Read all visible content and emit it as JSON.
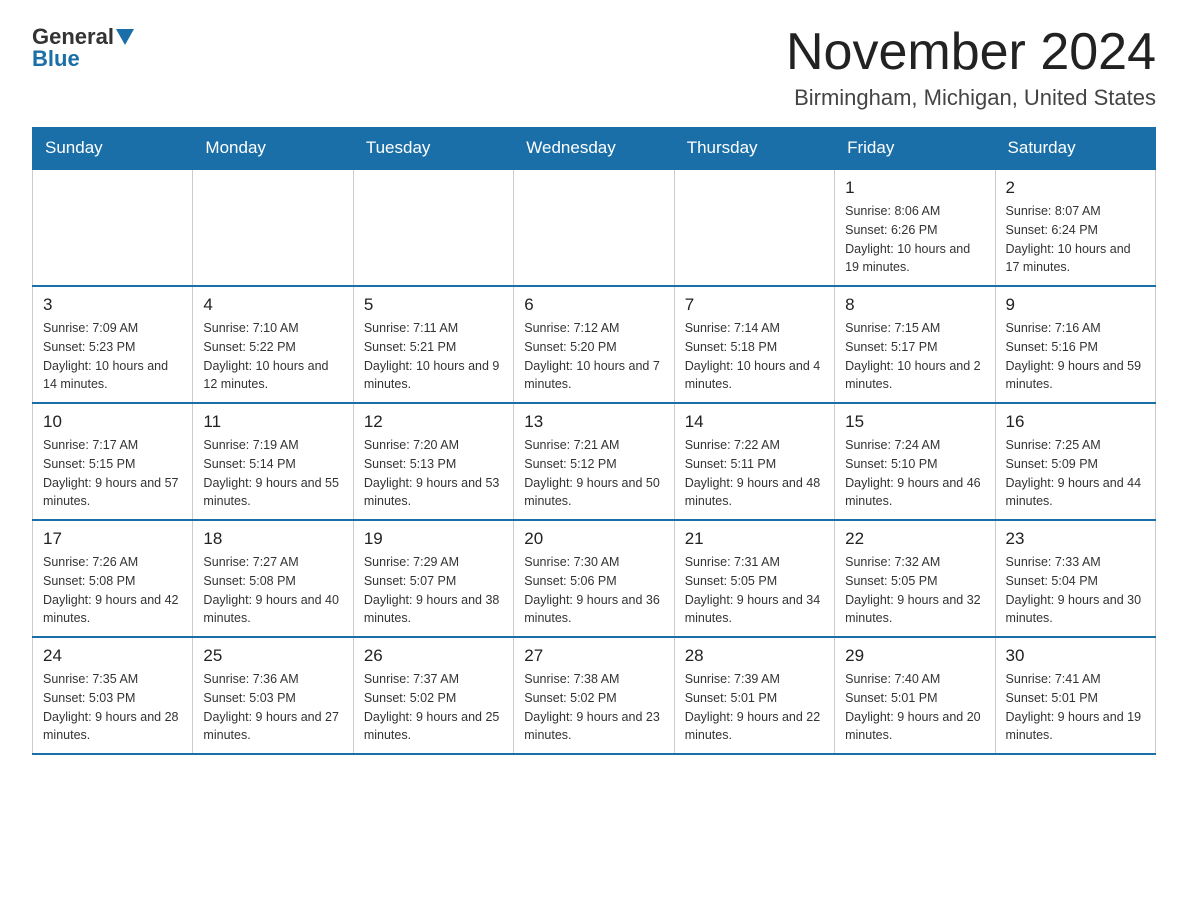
{
  "header": {
    "logo_general": "General",
    "logo_blue": "Blue",
    "month_title": "November 2024",
    "location": "Birmingham, Michigan, United States"
  },
  "days_of_week": [
    "Sunday",
    "Monday",
    "Tuesday",
    "Wednesday",
    "Thursday",
    "Friday",
    "Saturday"
  ],
  "weeks": [
    [
      {
        "day": "",
        "info": ""
      },
      {
        "day": "",
        "info": ""
      },
      {
        "day": "",
        "info": ""
      },
      {
        "day": "",
        "info": ""
      },
      {
        "day": "",
        "info": ""
      },
      {
        "day": "1",
        "info": "Sunrise: 8:06 AM\nSunset: 6:26 PM\nDaylight: 10 hours and 19 minutes."
      },
      {
        "day": "2",
        "info": "Sunrise: 8:07 AM\nSunset: 6:24 PM\nDaylight: 10 hours and 17 minutes."
      }
    ],
    [
      {
        "day": "3",
        "info": "Sunrise: 7:09 AM\nSunset: 5:23 PM\nDaylight: 10 hours and 14 minutes."
      },
      {
        "day": "4",
        "info": "Sunrise: 7:10 AM\nSunset: 5:22 PM\nDaylight: 10 hours and 12 minutes."
      },
      {
        "day": "5",
        "info": "Sunrise: 7:11 AM\nSunset: 5:21 PM\nDaylight: 10 hours and 9 minutes."
      },
      {
        "day": "6",
        "info": "Sunrise: 7:12 AM\nSunset: 5:20 PM\nDaylight: 10 hours and 7 minutes."
      },
      {
        "day": "7",
        "info": "Sunrise: 7:14 AM\nSunset: 5:18 PM\nDaylight: 10 hours and 4 minutes."
      },
      {
        "day": "8",
        "info": "Sunrise: 7:15 AM\nSunset: 5:17 PM\nDaylight: 10 hours and 2 minutes."
      },
      {
        "day": "9",
        "info": "Sunrise: 7:16 AM\nSunset: 5:16 PM\nDaylight: 9 hours and 59 minutes."
      }
    ],
    [
      {
        "day": "10",
        "info": "Sunrise: 7:17 AM\nSunset: 5:15 PM\nDaylight: 9 hours and 57 minutes."
      },
      {
        "day": "11",
        "info": "Sunrise: 7:19 AM\nSunset: 5:14 PM\nDaylight: 9 hours and 55 minutes."
      },
      {
        "day": "12",
        "info": "Sunrise: 7:20 AM\nSunset: 5:13 PM\nDaylight: 9 hours and 53 minutes."
      },
      {
        "day": "13",
        "info": "Sunrise: 7:21 AM\nSunset: 5:12 PM\nDaylight: 9 hours and 50 minutes."
      },
      {
        "day": "14",
        "info": "Sunrise: 7:22 AM\nSunset: 5:11 PM\nDaylight: 9 hours and 48 minutes."
      },
      {
        "day": "15",
        "info": "Sunrise: 7:24 AM\nSunset: 5:10 PM\nDaylight: 9 hours and 46 minutes."
      },
      {
        "day": "16",
        "info": "Sunrise: 7:25 AM\nSunset: 5:09 PM\nDaylight: 9 hours and 44 minutes."
      }
    ],
    [
      {
        "day": "17",
        "info": "Sunrise: 7:26 AM\nSunset: 5:08 PM\nDaylight: 9 hours and 42 minutes."
      },
      {
        "day": "18",
        "info": "Sunrise: 7:27 AM\nSunset: 5:08 PM\nDaylight: 9 hours and 40 minutes."
      },
      {
        "day": "19",
        "info": "Sunrise: 7:29 AM\nSunset: 5:07 PM\nDaylight: 9 hours and 38 minutes."
      },
      {
        "day": "20",
        "info": "Sunrise: 7:30 AM\nSunset: 5:06 PM\nDaylight: 9 hours and 36 minutes."
      },
      {
        "day": "21",
        "info": "Sunrise: 7:31 AM\nSunset: 5:05 PM\nDaylight: 9 hours and 34 minutes."
      },
      {
        "day": "22",
        "info": "Sunrise: 7:32 AM\nSunset: 5:05 PM\nDaylight: 9 hours and 32 minutes."
      },
      {
        "day": "23",
        "info": "Sunrise: 7:33 AM\nSunset: 5:04 PM\nDaylight: 9 hours and 30 minutes."
      }
    ],
    [
      {
        "day": "24",
        "info": "Sunrise: 7:35 AM\nSunset: 5:03 PM\nDaylight: 9 hours and 28 minutes."
      },
      {
        "day": "25",
        "info": "Sunrise: 7:36 AM\nSunset: 5:03 PM\nDaylight: 9 hours and 27 minutes."
      },
      {
        "day": "26",
        "info": "Sunrise: 7:37 AM\nSunset: 5:02 PM\nDaylight: 9 hours and 25 minutes."
      },
      {
        "day": "27",
        "info": "Sunrise: 7:38 AM\nSunset: 5:02 PM\nDaylight: 9 hours and 23 minutes."
      },
      {
        "day": "28",
        "info": "Sunrise: 7:39 AM\nSunset: 5:01 PM\nDaylight: 9 hours and 22 minutes."
      },
      {
        "day": "29",
        "info": "Sunrise: 7:40 AM\nSunset: 5:01 PM\nDaylight: 9 hours and 20 minutes."
      },
      {
        "day": "30",
        "info": "Sunrise: 7:41 AM\nSunset: 5:01 PM\nDaylight: 9 hours and 19 minutes."
      }
    ]
  ]
}
